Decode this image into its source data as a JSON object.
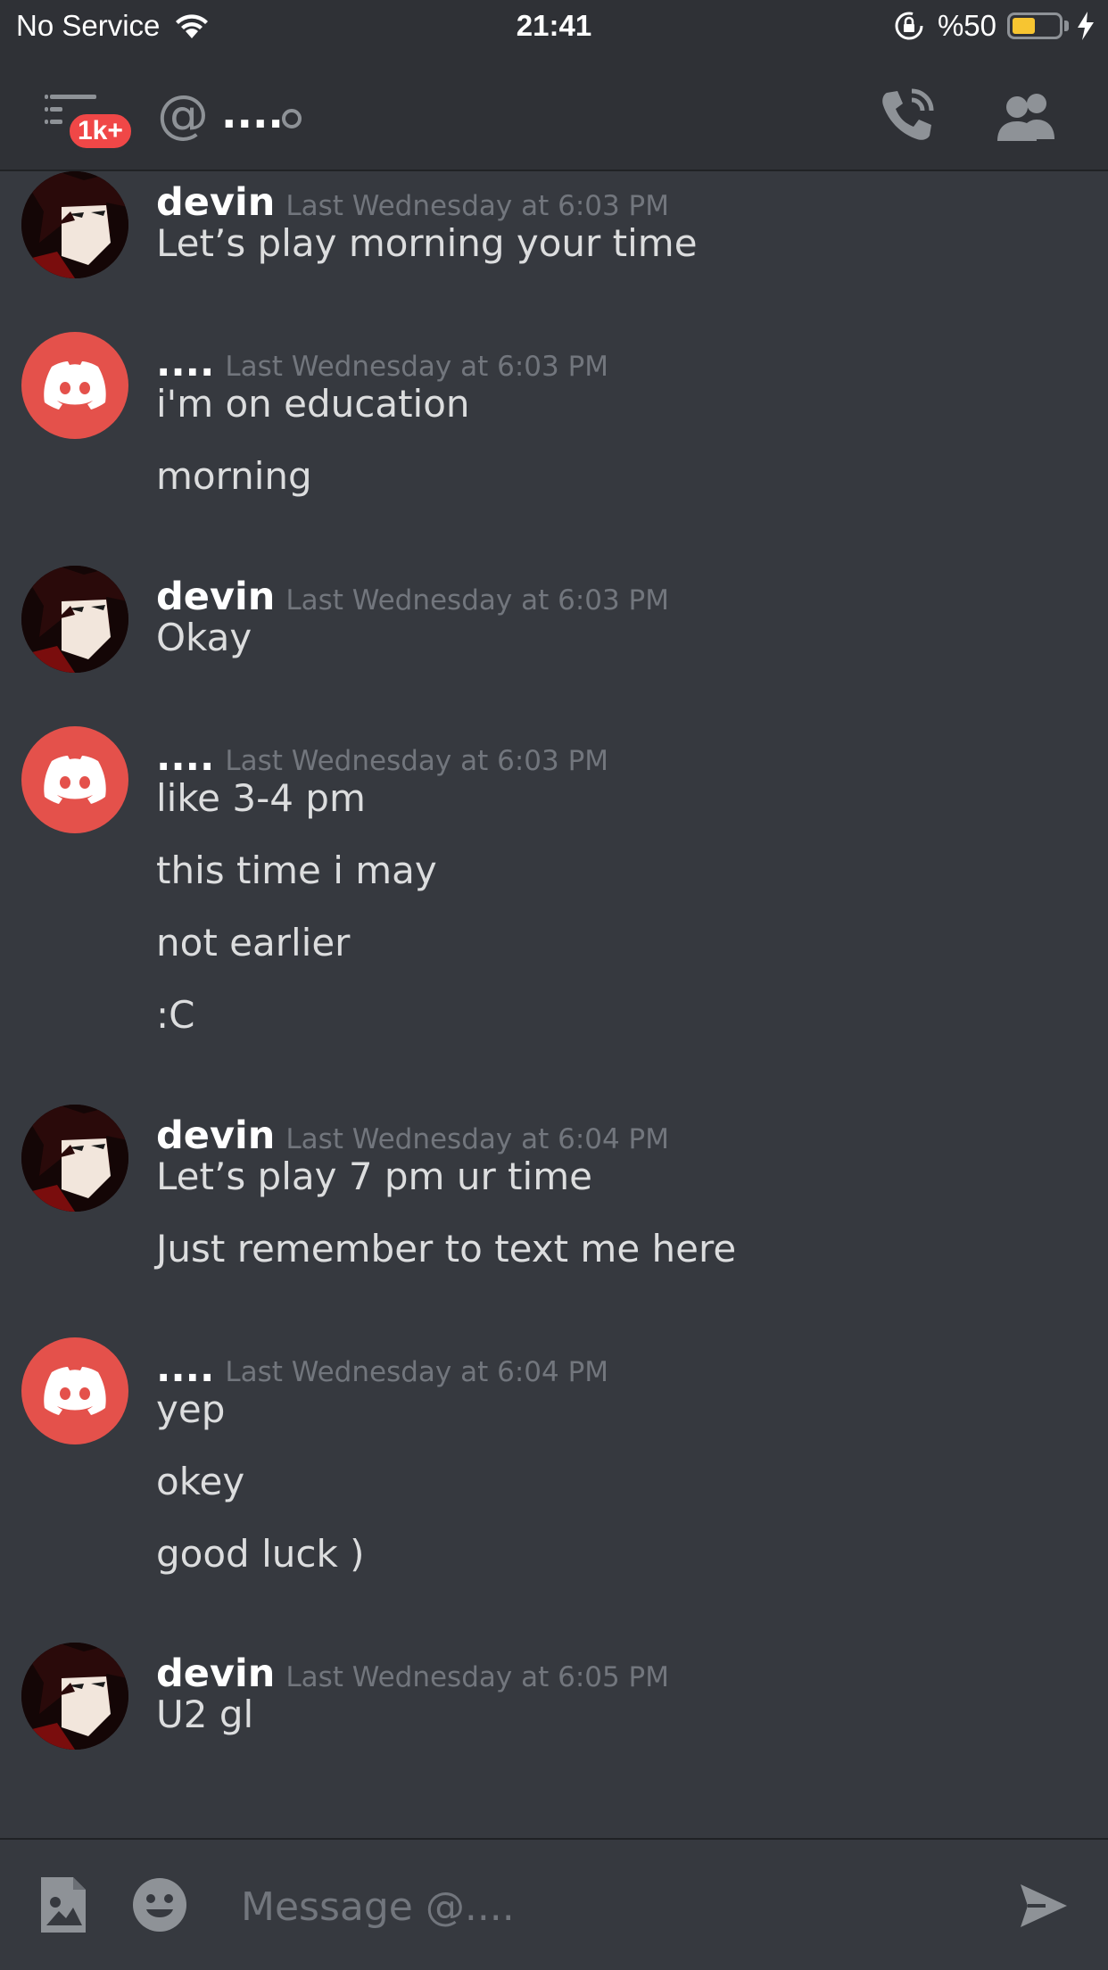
{
  "status_bar": {
    "carrier": "No Service",
    "time": "21:41",
    "battery_text": "%50",
    "battery_level": 0.5,
    "battery_color": "#f7c531"
  },
  "header": {
    "badge": "1k+",
    "channel_name": "....",
    "icons": [
      "hamburger-menu-icon",
      "at-icon",
      "offline-status-icon",
      "phone-call-icon",
      "members-icon"
    ]
  },
  "messages": [
    {
      "author": "devin",
      "avatar": "anime-avatar",
      "timestamp": "Last Wednesday at 6:03 PM",
      "lines": [
        "Let’s play morning your time"
      ]
    },
    {
      "author": "....",
      "avatar": "discord-avatar",
      "timestamp": "Last Wednesday at 6:03 PM",
      "lines": [
        "i'm on education",
        "morning"
      ]
    },
    {
      "author": "devin",
      "avatar": "anime-avatar",
      "timestamp": "Last Wednesday at 6:03 PM",
      "lines": [
        "Okay"
      ]
    },
    {
      "author": "....",
      "avatar": "discord-avatar",
      "timestamp": "Last Wednesday at 6:03 PM",
      "lines": [
        "like  3-4 pm",
        "this time i may",
        "not earlier",
        ":C"
      ]
    },
    {
      "author": "devin",
      "avatar": "anime-avatar",
      "timestamp": "Last Wednesday at 6:04 PM",
      "lines": [
        "Let’s play 7 pm ur time",
        "Just remember to text me here"
      ]
    },
    {
      "author": "....",
      "avatar": "discord-avatar",
      "timestamp": "Last Wednesday at 6:04 PM",
      "lines": [
        "yep",
        "okey",
        "good luck )"
      ]
    },
    {
      "author": "devin",
      "avatar": "anime-avatar",
      "timestamp": "Last Wednesday at 6:05 PM",
      "lines": [
        "U2 gl"
      ]
    }
  ],
  "input": {
    "placeholder": "Message @....",
    "value": ""
  },
  "colors": {
    "background": "#36393f",
    "header": "#2f3136",
    "badge": "#f04747",
    "discord_avatar": "#e4514b"
  }
}
